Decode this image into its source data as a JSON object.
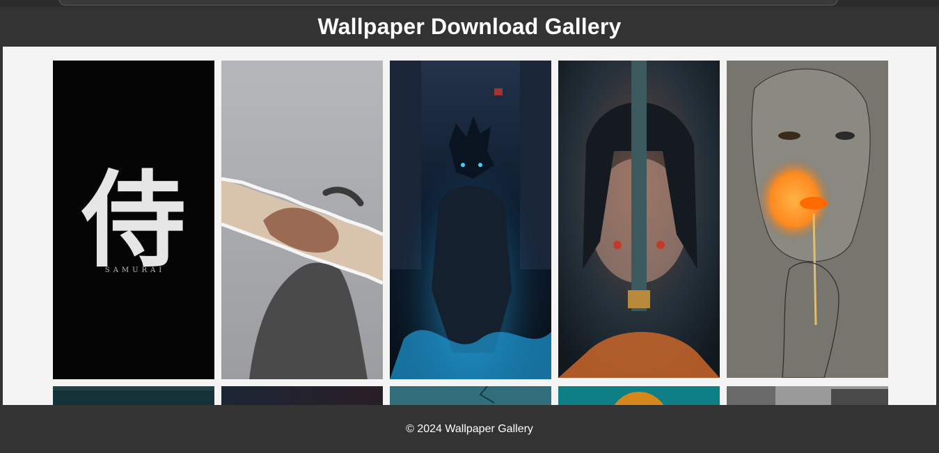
{
  "header": {
    "title": "Wallpaper Download Gallery"
  },
  "gallery": {
    "items": [
      {
        "subject": "samurai-kanji",
        "kanji": "侍",
        "caption": "SAMURAI",
        "colors": [
          "#050505",
          "#e8e8e8"
        ]
      },
      {
        "subject": "torn-paper-hands",
        "colors": [
          "#a9abae",
          "#d7c0a8"
        ]
      },
      {
        "subject": "anime-boy-alley",
        "colors": [
          "#0b1a2c",
          "#1ea7ff"
        ]
      },
      {
        "subject": "woman-with-sword",
        "colors": [
          "#162028",
          "#e06b2a"
        ]
      },
      {
        "subject": "sketch-girl-match",
        "colors": [
          "#7a7a72",
          "#ff8a1f"
        ]
      },
      {
        "subject": "dark-sea",
        "colors": [
          "#163238"
        ]
      },
      {
        "subject": "dark-gradient",
        "colors": [
          "#1c2330"
        ]
      },
      {
        "subject": "teal-wall",
        "colors": [
          "#2f6e7a"
        ]
      },
      {
        "subject": "orange-sun-teal",
        "colors": [
          "#0f7f86",
          "#d5871c"
        ]
      },
      {
        "subject": "grayscale-street",
        "colors": [
          "#9a9a9a"
        ]
      }
    ]
  },
  "footer": {
    "text": "© 2024 Wallpaper Gallery"
  }
}
